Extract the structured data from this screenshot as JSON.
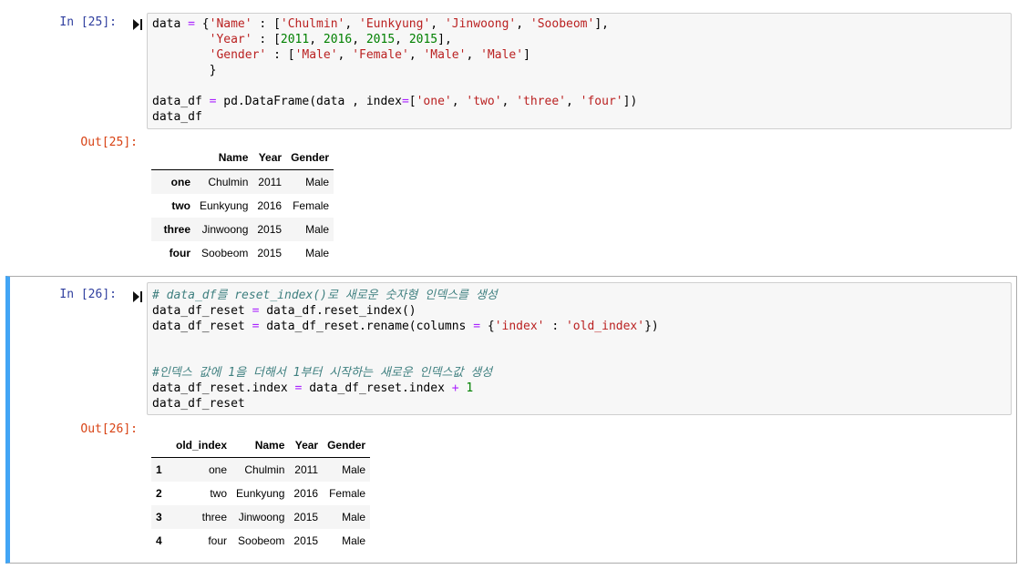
{
  "cell25": {
    "prompt_in": "In [25]:",
    "prompt_out": "Out[25]:",
    "code_lines": [
      [
        {
          "t": "data ",
          "c": ""
        },
        {
          "t": "=",
          "c": "kw-op"
        },
        {
          "t": " {",
          "c": ""
        },
        {
          "t": "'Name'",
          "c": "str"
        },
        {
          "t": " : [",
          "c": ""
        },
        {
          "t": "'Chulmin'",
          "c": "str"
        },
        {
          "t": ", ",
          "c": ""
        },
        {
          "t": "'Eunkyung'",
          "c": "str"
        },
        {
          "t": ", ",
          "c": ""
        },
        {
          "t": "'Jinwoong'",
          "c": "str"
        },
        {
          "t": ", ",
          "c": ""
        },
        {
          "t": "'Soobeom'",
          "c": "str"
        },
        {
          "t": "],",
          "c": ""
        }
      ],
      [
        {
          "t": "        ",
          "c": ""
        },
        {
          "t": "'Year'",
          "c": "str"
        },
        {
          "t": " : [",
          "c": ""
        },
        {
          "t": "2011",
          "c": "num"
        },
        {
          "t": ", ",
          "c": ""
        },
        {
          "t": "2016",
          "c": "num"
        },
        {
          "t": ", ",
          "c": ""
        },
        {
          "t": "2015",
          "c": "num"
        },
        {
          "t": ", ",
          "c": ""
        },
        {
          "t": "2015",
          "c": "num"
        },
        {
          "t": "],",
          "c": ""
        }
      ],
      [
        {
          "t": "        ",
          "c": ""
        },
        {
          "t": "'Gender'",
          "c": "str"
        },
        {
          "t": " : [",
          "c": ""
        },
        {
          "t": "'Male'",
          "c": "str"
        },
        {
          "t": ", ",
          "c": ""
        },
        {
          "t": "'Female'",
          "c": "str"
        },
        {
          "t": ", ",
          "c": ""
        },
        {
          "t": "'Male'",
          "c": "str"
        },
        {
          "t": ", ",
          "c": ""
        },
        {
          "t": "'Male'",
          "c": "str"
        },
        {
          "t": "]",
          "c": ""
        }
      ],
      [
        {
          "t": "        }",
          "c": ""
        }
      ],
      [],
      [
        {
          "t": "data_df ",
          "c": ""
        },
        {
          "t": "=",
          "c": "kw-op"
        },
        {
          "t": " pd.DataFrame(data , index",
          "c": ""
        },
        {
          "t": "=",
          "c": "kw-op"
        },
        {
          "t": "[",
          "c": ""
        },
        {
          "t": "'one'",
          "c": "str"
        },
        {
          "t": ", ",
          "c": ""
        },
        {
          "t": "'two'",
          "c": "str"
        },
        {
          "t": ", ",
          "c": ""
        },
        {
          "t": "'three'",
          "c": "str"
        },
        {
          "t": ", ",
          "c": ""
        },
        {
          "t": "'four'",
          "c": "str"
        },
        {
          "t": "])",
          "c": ""
        }
      ],
      [
        {
          "t": "data_df",
          "c": ""
        }
      ]
    ],
    "table": {
      "columns": [
        "",
        "Name",
        "Year",
        "Gender"
      ],
      "rows": [
        [
          "one",
          "Chulmin",
          "2011",
          "Male"
        ],
        [
          "two",
          "Eunkyung",
          "2016",
          "Female"
        ],
        [
          "three",
          "Jinwoong",
          "2015",
          "Male"
        ],
        [
          "four",
          "Soobeom",
          "2015",
          "Male"
        ]
      ]
    }
  },
  "cell26": {
    "prompt_in": "In [26]:",
    "prompt_out": "Out[26]:",
    "code_lines": [
      [
        {
          "t": "# data_df를 reset_index()로 새로운 숫자형 인덱스를 생성",
          "c": "cmt"
        }
      ],
      [
        {
          "t": "data_df_reset ",
          "c": ""
        },
        {
          "t": "=",
          "c": "kw-op"
        },
        {
          "t": " data_df.reset_index()",
          "c": ""
        }
      ],
      [
        {
          "t": "data_df_reset ",
          "c": ""
        },
        {
          "t": "=",
          "c": "kw-op"
        },
        {
          "t": " data_df_reset.rename(columns ",
          "c": ""
        },
        {
          "t": "=",
          "c": "kw-op"
        },
        {
          "t": " {",
          "c": ""
        },
        {
          "t": "'index'",
          "c": "str"
        },
        {
          "t": " : ",
          "c": ""
        },
        {
          "t": "'old_index'",
          "c": "str"
        },
        {
          "t": "})",
          "c": ""
        }
      ],
      [],
      [],
      [
        {
          "t": "#인덱스 값에 1을 더해서 1부터 시작하는 새로운 인덱스값 생성",
          "c": "cmt"
        }
      ],
      [
        {
          "t": "data_df_reset.index ",
          "c": ""
        },
        {
          "t": "=",
          "c": "kw-op"
        },
        {
          "t": " data_df_reset.index ",
          "c": ""
        },
        {
          "t": "+",
          "c": "kw-op"
        },
        {
          "t": " ",
          "c": ""
        },
        {
          "t": "1",
          "c": "num"
        }
      ],
      [
        {
          "t": "data_df_reset",
          "c": ""
        }
      ]
    ],
    "table": {
      "columns": [
        "",
        "old_index",
        "Name",
        "Year",
        "Gender"
      ],
      "rows": [
        [
          "1",
          "one",
          "Chulmin",
          "2011",
          "Male"
        ],
        [
          "2",
          "two",
          "Eunkyung",
          "2016",
          "Female"
        ],
        [
          "3",
          "three",
          "Jinwoong",
          "2015",
          "Male"
        ],
        [
          "4",
          "four",
          "Soobeom",
          "2015",
          "Male"
        ]
      ]
    }
  },
  "icons": {
    "run": "run-cell-icon"
  },
  "colors": {
    "selected_border": "#42a5f5",
    "prompt_in": "#303f9f",
    "prompt_out": "#d84315",
    "string": "#ba2121",
    "number": "#008000",
    "operator": "#aa22ff",
    "comment": "#408080"
  }
}
